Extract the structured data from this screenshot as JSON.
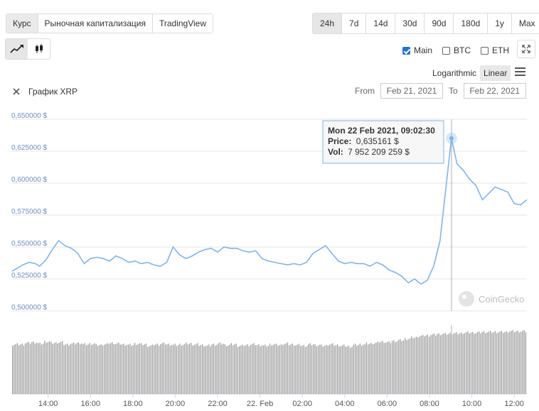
{
  "tabs": [
    {
      "label": "Курс",
      "active": true
    },
    {
      "label": "Рыночная капитализация",
      "active": false
    },
    {
      "label": "TradingView",
      "active": false
    }
  ],
  "ranges": [
    {
      "label": "24h",
      "active": true
    },
    {
      "label": "7d",
      "active": false
    },
    {
      "label": "14d",
      "active": false
    },
    {
      "label": "30d",
      "active": false
    },
    {
      "label": "90d",
      "active": false
    },
    {
      "label": "180d",
      "active": false
    },
    {
      "label": "1y",
      "active": false
    },
    {
      "label": "Max",
      "active": false
    }
  ],
  "chart_types": [
    {
      "icon": "line-chart-icon",
      "active": true
    },
    {
      "icon": "candlestick-icon",
      "active": false
    }
  ],
  "compare": [
    {
      "label": "Main",
      "checked": true
    },
    {
      "label": "BTC",
      "checked": false
    },
    {
      "label": "ETH",
      "checked": false
    }
  ],
  "scale": {
    "logarithmic": "Logarithmic",
    "linear": "Linear",
    "active": "linear"
  },
  "series_title": "График XRP",
  "date_range": {
    "from_label": "From",
    "from_value": "Feb 21, 2021",
    "to_label": "To",
    "to_value": "Feb 22, 2021"
  },
  "tooltip": {
    "date": "Mon 22 Feb 2021, 09:02:30",
    "price_label": "Price:",
    "price_value": "0,635161 $",
    "vol_label": "Vol:",
    "vol_value": "7 952 209 259 $"
  },
  "watermark": "CoinGecko",
  "colors": {
    "line": "#7cb5ec",
    "bars": "#9a9a9a",
    "tooltip_border": "#7cb5ec",
    "grid": "#e6e6e6",
    "axis_text": "#6d8fc5"
  },
  "chart_data": {
    "type": "line",
    "title": "График XRP",
    "y_ticks": [
      {
        "value": 0.65,
        "label": "0,650000 $"
      },
      {
        "value": 0.625,
        "label": "0,625000 $"
      },
      {
        "value": 0.6,
        "label": "0,600000 $"
      },
      {
        "value": 0.575,
        "label": "0,575000 $"
      },
      {
        "value": 0.55,
        "label": "0,550000 $"
      },
      {
        "value": 0.525,
        "label": "0,525000 $"
      },
      {
        "value": 0.5,
        "label": "0,500000 $"
      }
    ],
    "ylim": [
      0.5,
      0.65
    ],
    "x_ticks": [
      {
        "t": 14,
        "label": "14:00"
      },
      {
        "t": 16,
        "label": "16:00"
      },
      {
        "t": 18,
        "label": "18:00"
      },
      {
        "t": 20,
        "label": "20:00"
      },
      {
        "t": 22,
        "label": "22:00"
      },
      {
        "t": 24,
        "label": "22. Feb"
      },
      {
        "t": 26,
        "label": "02:00"
      },
      {
        "t": 28,
        "label": "04:00"
      },
      {
        "t": 30,
        "label": "06:00"
      },
      {
        "t": 32,
        "label": "08:00"
      },
      {
        "t": 34,
        "label": "10:00"
      },
      {
        "t": 36,
        "label": "12:00"
      }
    ],
    "xlim": [
      12.3,
      36.6
    ],
    "hover_t": 33.04,
    "price": [
      [
        12.3,
        0.531
      ],
      [
        12.8,
        0.536
      ],
      [
        13.1,
        0.538
      ],
      [
        13.4,
        0.537
      ],
      [
        13.6,
        0.535
      ],
      [
        13.9,
        0.54
      ],
      [
        14.2,
        0.548
      ],
      [
        14.5,
        0.555
      ],
      [
        14.8,
        0.551
      ],
      [
        15.1,
        0.549
      ],
      [
        15.4,
        0.545
      ],
      [
        15.7,
        0.537
      ],
      [
        16.0,
        0.541
      ],
      [
        16.3,
        0.542
      ],
      [
        16.6,
        0.541
      ],
      [
        16.9,
        0.539
      ],
      [
        17.2,
        0.543
      ],
      [
        17.5,
        0.541
      ],
      [
        17.8,
        0.538
      ],
      [
        18.1,
        0.539
      ],
      [
        18.4,
        0.537
      ],
      [
        18.7,
        0.538
      ],
      [
        19.0,
        0.536
      ],
      [
        19.3,
        0.535
      ],
      [
        19.6,
        0.538
      ],
      [
        19.9,
        0.55
      ],
      [
        20.2,
        0.544
      ],
      [
        20.5,
        0.541
      ],
      [
        20.8,
        0.543
      ],
      [
        21.1,
        0.546
      ],
      [
        21.4,
        0.548
      ],
      [
        21.7,
        0.549
      ],
      [
        22.0,
        0.546
      ],
      [
        22.3,
        0.55
      ],
      [
        22.6,
        0.549
      ],
      [
        22.9,
        0.549
      ],
      [
        23.2,
        0.547
      ],
      [
        23.5,
        0.546
      ],
      [
        23.8,
        0.547
      ],
      [
        24.1,
        0.541
      ],
      [
        24.4,
        0.539
      ],
      [
        24.7,
        0.538
      ],
      [
        25.0,
        0.537
      ],
      [
        25.3,
        0.536
      ],
      [
        25.6,
        0.537
      ],
      [
        25.9,
        0.536
      ],
      [
        26.2,
        0.538
      ],
      [
        26.5,
        0.545
      ],
      [
        26.8,
        0.548
      ],
      [
        27.1,
        0.551
      ],
      [
        27.4,
        0.545
      ],
      [
        27.7,
        0.539
      ],
      [
        28.0,
        0.537
      ],
      [
        28.3,
        0.538
      ],
      [
        28.6,
        0.537
      ],
      [
        28.9,
        0.537
      ],
      [
        29.2,
        0.535
      ],
      [
        29.5,
        0.538
      ],
      [
        29.8,
        0.536
      ],
      [
        30.1,
        0.532
      ],
      [
        30.4,
        0.53
      ],
      [
        30.7,
        0.527
      ],
      [
        31.0,
        0.522
      ],
      [
        31.3,
        0.525
      ],
      [
        31.6,
        0.521
      ],
      [
        31.9,
        0.524
      ],
      [
        32.2,
        0.535
      ],
      [
        32.5,
        0.555
      ],
      [
        32.8,
        0.6
      ],
      [
        33.04,
        0.635161
      ],
      [
        33.3,
        0.615
      ],
      [
        33.6,
        0.61
      ],
      [
        33.9,
        0.603
      ],
      [
        34.2,
        0.598
      ],
      [
        34.5,
        0.587
      ],
      [
        34.8,
        0.592
      ],
      [
        35.1,
        0.597
      ],
      [
        35.4,
        0.595
      ],
      [
        35.7,
        0.593
      ],
      [
        36.0,
        0.584
      ],
      [
        36.3,
        0.583
      ],
      [
        36.6,
        0.587
      ]
    ],
    "volume_relative": [
      0.72,
      0.72,
      0.74,
      0.75,
      0.73,
      0.76,
      0.74,
      0.75,
      0.72,
      0.73,
      0.74,
      0.72,
      0.73,
      0.71,
      0.72,
      0.74,
      0.73,
      0.72,
      0.71,
      0.73,
      0.72,
      0.7,
      0.72,
      0.73,
      0.72,
      0.71,
      0.72,
      0.73,
      0.72,
      0.71,
      0.7,
      0.72,
      0.73,
      0.71,
      0.72,
      0.7,
      0.71,
      0.72,
      0.71,
      0.7,
      0.72,
      0.71,
      0.73,
      0.72,
      0.71,
      0.7,
      0.72,
      0.71,
      0.7,
      0.72,
      0.71,
      0.7,
      0.69,
      0.71,
      0.72,
      0.73,
      0.74,
      0.76,
      0.75,
      0.77,
      0.78,
      0.8,
      0.82,
      0.84,
      0.85,
      0.86,
      0.87,
      0.87,
      0.88,
      0.88,
      0.89,
      0.89,
      0.89,
      0.9,
      0.9,
      0.9,
      0.9,
      0.91,
      0.91,
      0.91
    ]
  }
}
